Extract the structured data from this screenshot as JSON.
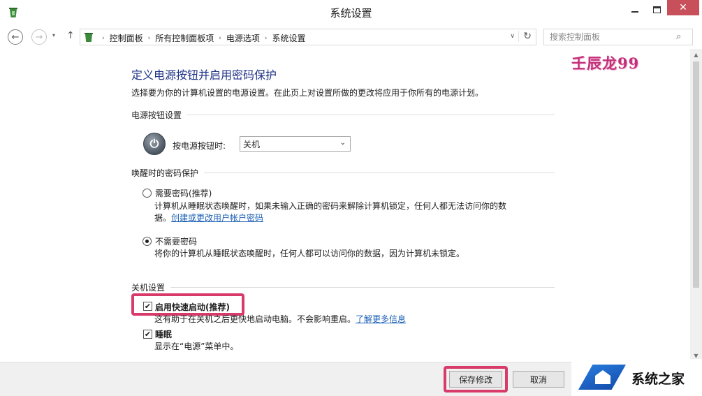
{
  "window": {
    "title": "系统设置",
    "close_glyph": "✕",
    "app_icon": "recycle-bin-icon"
  },
  "nav": {
    "back_glyph": "←",
    "forward_glyph": "→",
    "up_glyph": "↑",
    "recent_glyph": "▾",
    "breadcrumb": [
      "控制面板",
      "所有控制面板项",
      "电源选项",
      "系统设置"
    ],
    "crumb_sep": "›",
    "dropdown_glyph": "∨",
    "refresh_glyph": "↻",
    "search_placeholder": "搜索控制面板",
    "search_glyph": "⌕"
  },
  "page": {
    "title": "定义电源按钮并启用密码保护",
    "description": "选择要为你的计算机设置的电源设置。在此页上对设置所做的更改将应用于你所有的电源计划。"
  },
  "power_button": {
    "section": "电源按钮设置",
    "label": "按电源按钮时:",
    "value": "关机",
    "power_glyph": "⏻",
    "arrow_glyph": "⌄"
  },
  "wake_password": {
    "section": "唤醒时的密码保护",
    "options": [
      {
        "title": "需要密码(推荐)",
        "desc": "计算机从睡眠状态唤醒时，如果未输入正确的密码来解除计算机锁定，任何人都无法访问你的数",
        "desc2": "据。",
        "link": "创建或更改用户帐户密码",
        "selected": false
      },
      {
        "title": "不需要密码",
        "desc": "将你的计算机从睡眠状态唤醒时，任何人都可以访问你的数据，因为计算机未锁定。",
        "selected": true
      }
    ]
  },
  "shutdown": {
    "section": "关机设置",
    "check_glyph": "✔",
    "fast_startup": {
      "label": "启用快速启动(推荐)",
      "desc": "这有助于在关机之后更快地启动电脑。不会影响重启。",
      "link": "了解更多信息",
      "checked": true
    },
    "sleep": {
      "label": "睡眠",
      "desc": "显示在“电源”菜单中。",
      "checked": true
    }
  },
  "scrollbar": {
    "up_glyph": "▲",
    "down_glyph": "▼"
  },
  "footer": {
    "save": "保存修改",
    "cancel": "取消"
  },
  "watermarks": {
    "top": "壬辰龙99",
    "bottom": "系统之家"
  },
  "colors": {
    "highlight": "#d83b6a",
    "title_blue": "#1e3287",
    "link": "#1a5fb4",
    "close": "#c7505a"
  }
}
